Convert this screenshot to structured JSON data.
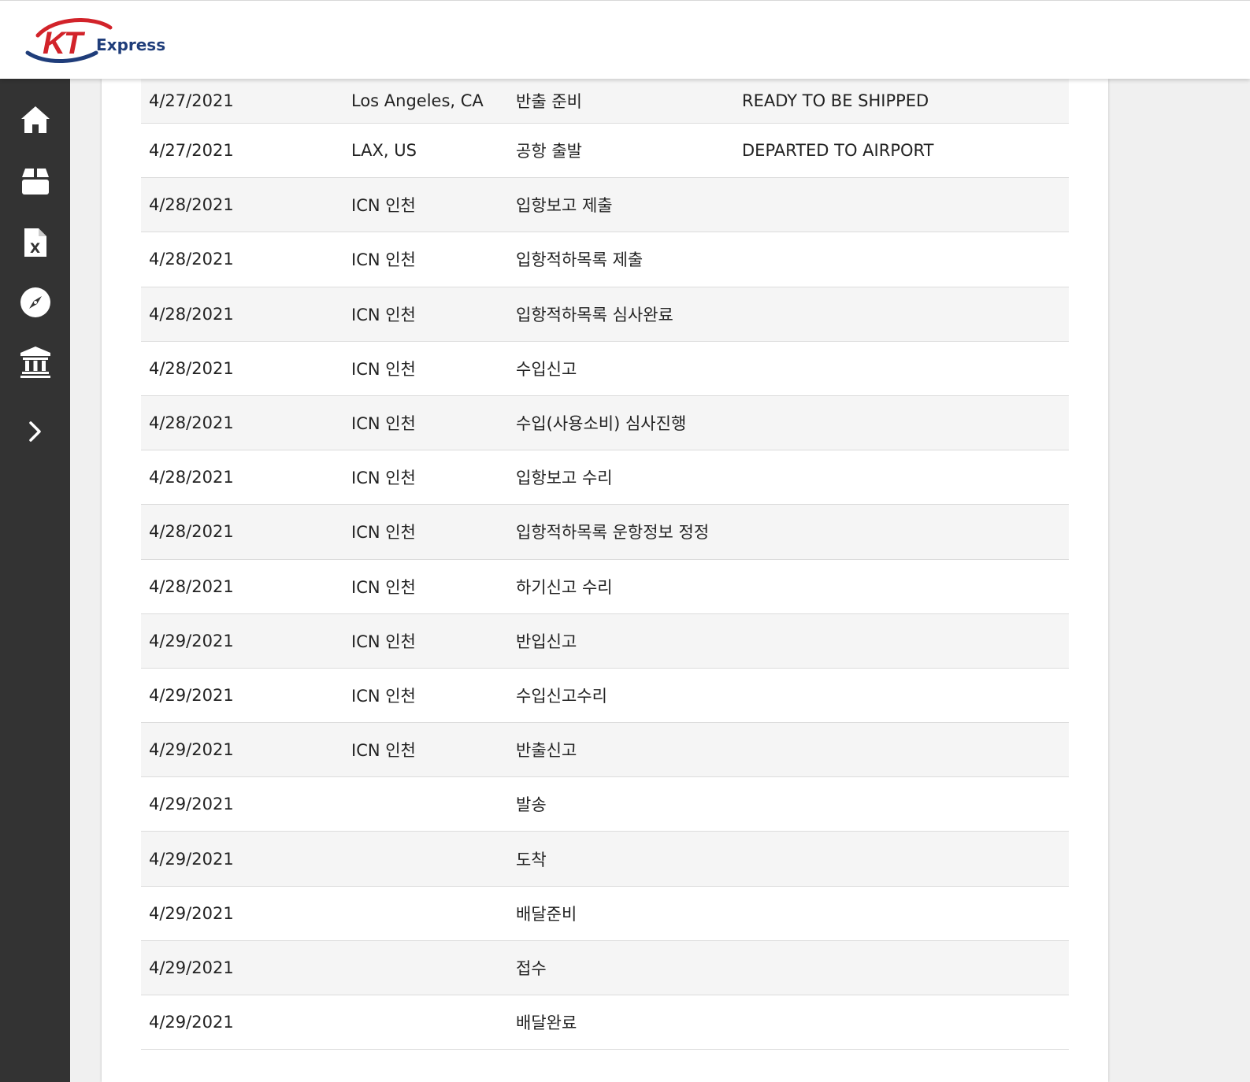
{
  "brand": {
    "logo_text": "Express",
    "logo_letters": "KT",
    "colors": {
      "red": "#d2232a",
      "navy": "#1f3d7a",
      "sidebar": "#333333"
    }
  },
  "sidebar": {
    "items": [
      {
        "icon": "home-icon"
      },
      {
        "icon": "package-icon"
      },
      {
        "icon": "excel-file-icon"
      },
      {
        "icon": "compass-icon"
      },
      {
        "icon": "bank-icon"
      },
      {
        "icon": "chevron-right-icon"
      }
    ]
  },
  "tracking": {
    "rows": [
      {
        "date": "4/27/2021",
        "location": "Los Angeles, CA",
        "status": "반출 준비",
        "status_en": "READY TO BE SHIPPED"
      },
      {
        "date": "4/27/2021",
        "location": "LAX, US",
        "status": "공항 출발",
        "status_en": "DEPARTED TO AIRPORT"
      },
      {
        "date": "4/28/2021",
        "location": "ICN 인천",
        "status": "입항보고 제출",
        "status_en": ""
      },
      {
        "date": "4/28/2021",
        "location": "ICN 인천",
        "status": "입항적하목록 제출",
        "status_en": ""
      },
      {
        "date": "4/28/2021",
        "location": "ICN 인천",
        "status": "입항적하목록 심사완료",
        "status_en": ""
      },
      {
        "date": "4/28/2021",
        "location": "ICN 인천",
        "status": "수입신고",
        "status_en": ""
      },
      {
        "date": "4/28/2021",
        "location": "ICN 인천",
        "status": "수입(사용소비) 심사진행",
        "status_en": ""
      },
      {
        "date": "4/28/2021",
        "location": "ICN 인천",
        "status": "입항보고 수리",
        "status_en": ""
      },
      {
        "date": "4/28/2021",
        "location": "ICN 인천",
        "status": "입항적하목록 운항정보 정정",
        "status_en": ""
      },
      {
        "date": "4/28/2021",
        "location": "ICN 인천",
        "status": "하기신고 수리",
        "status_en": ""
      },
      {
        "date": "4/29/2021",
        "location": "ICN 인천",
        "status": "반입신고",
        "status_en": ""
      },
      {
        "date": "4/29/2021",
        "location": "ICN 인천",
        "status": "수입신고수리",
        "status_en": ""
      },
      {
        "date": "4/29/2021",
        "location": "ICN 인천",
        "status": "반출신고",
        "status_en": ""
      },
      {
        "date": "4/29/2021",
        "location": "",
        "status": "발송",
        "status_en": ""
      },
      {
        "date": "4/29/2021",
        "location": "",
        "status": "도착",
        "status_en": ""
      },
      {
        "date": "4/29/2021",
        "location": "",
        "status": "배달준비",
        "status_en": ""
      },
      {
        "date": "4/29/2021",
        "location": "",
        "status": "접수",
        "status_en": ""
      },
      {
        "date": "4/29/2021",
        "location": "",
        "status": "배달완료",
        "status_en": ""
      }
    ]
  }
}
